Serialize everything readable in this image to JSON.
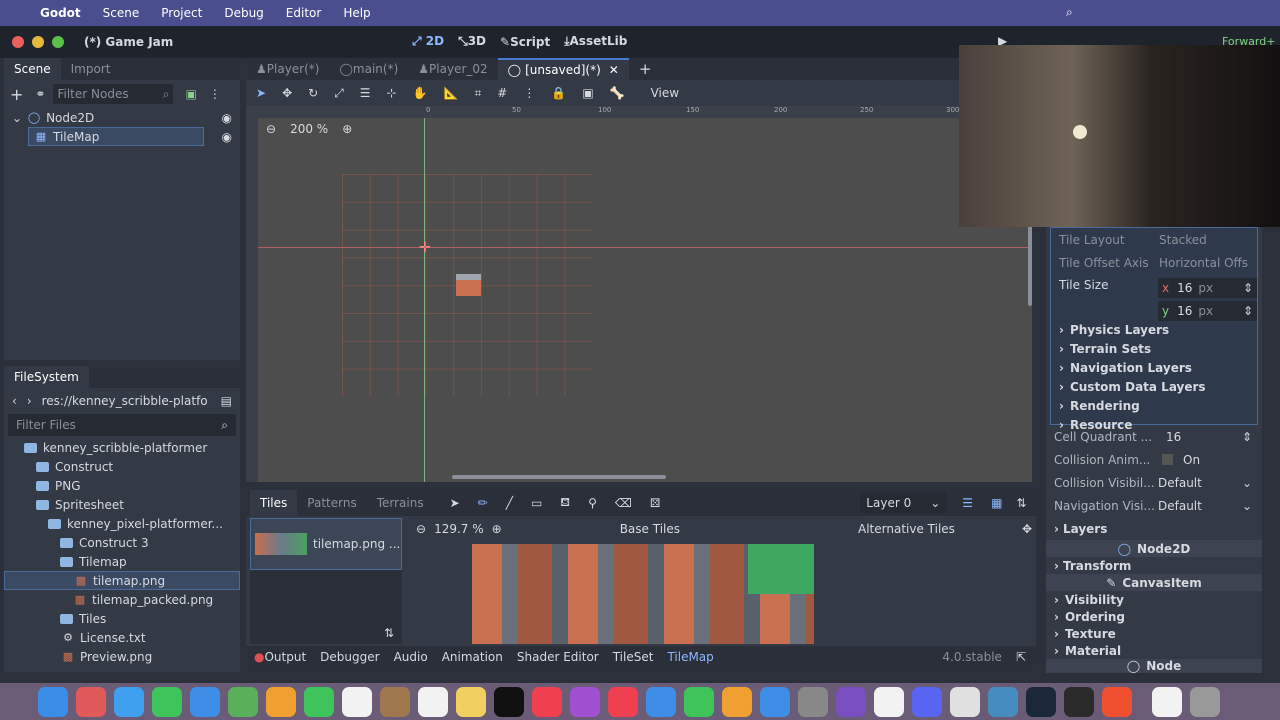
{
  "macos_menu": {
    "items": [
      "Godot",
      "Scene",
      "Project",
      "Debug",
      "Editor",
      "Help"
    ]
  },
  "editor_top": {
    "window_title": "(*) Game Jam",
    "workspaces": [
      "2D",
      "3D",
      "Script",
      "AssetLib"
    ],
    "renderer": "Forward+"
  },
  "scene_dock": {
    "tabs": [
      "Scene",
      "Import"
    ],
    "filter_placeholder": "Filter Nodes",
    "nodes": [
      "Node2D",
      "TileMap"
    ]
  },
  "filesystem_dock": {
    "title": "FileSystem",
    "path": "res://kenney_scribble-platfo",
    "filter_placeholder": "Filter Files",
    "items": [
      {
        "label": "kenney_scribble-platformer",
        "type": "folder",
        "indent": 1
      },
      {
        "label": "Construct",
        "type": "folder",
        "indent": 2
      },
      {
        "label": "PNG",
        "type": "folder",
        "indent": 2
      },
      {
        "label": "Spritesheet",
        "type": "folder",
        "indent": 2
      },
      {
        "label": "kenney_pixel-platformer...",
        "type": "folder",
        "indent": 3
      },
      {
        "label": "Construct 3",
        "type": "folder",
        "indent": 4
      },
      {
        "label": "Tilemap",
        "type": "folder",
        "indent": 4
      },
      {
        "label": "tilemap.png",
        "type": "image",
        "indent": 5
      },
      {
        "label": "tilemap_packed.png",
        "type": "image",
        "indent": 5
      },
      {
        "label": "Tiles",
        "type": "folder",
        "indent": 4
      },
      {
        "label": "License.txt",
        "type": "gear",
        "indent": 4
      },
      {
        "label": "Preview.png",
        "type": "image",
        "indent": 4
      }
    ]
  },
  "editor_tabs": [
    "Player(*)",
    "main(*)",
    "Player_02",
    "[unsaved](*)"
  ],
  "toolbar": {
    "view_label": "View"
  },
  "viewport": {
    "zoom": "200 %",
    "ruler_marks": [
      "0",
      "50",
      "100",
      "150",
      "200",
      "250",
      "300"
    ]
  },
  "tileset_panel": {
    "tabs": [
      "Tiles",
      "Patterns",
      "Terrains"
    ],
    "layer_select": "Layer 0",
    "source_item": "tilemap.png ...",
    "zoom": "129.7 %",
    "base_tiles_label": "Base Tiles",
    "alt_tiles_label": "Alternative Tiles"
  },
  "bottom_tabs": [
    "Output",
    "Debugger",
    "Audio",
    "Animation",
    "Shader Editor",
    "TileSet",
    "TileMap"
  ],
  "version": "4.0.stable",
  "inspector": {
    "tile_layout": {
      "label": "Tile Layout",
      "value": "Stacked"
    },
    "tile_offset_axis": {
      "label": "Tile Offset Axis",
      "value": "Horizontal Offs"
    },
    "tile_size": {
      "label": "Tile Size",
      "x_label": "x",
      "x": "16",
      "y_label": "y",
      "y": "16",
      "unit": "px"
    },
    "sections": [
      "Physics Layers",
      "Terrain Sets",
      "Navigation Layers",
      "Custom Data Layers",
      "Rendering",
      "Resource"
    ],
    "cell_quadrant": {
      "label": "Cell Quadrant ...",
      "value": "16"
    },
    "collision_anim": {
      "label": "Collision Anim...",
      "value": "On"
    },
    "collision_vis": {
      "label": "Collision Visibil...",
      "value": "Default"
    },
    "navigation_vis": {
      "label": "Navigation Visi...",
      "value": "Default"
    },
    "layers_label": "Layers",
    "node2d_header": "Node2D",
    "transform_label": "Transform",
    "canvasitem_header": "CanvasItem",
    "canvas_sections": [
      "Visibility",
      "Ordering",
      "Texture",
      "Material"
    ],
    "node_header": "Node"
  },
  "colors": {
    "accent": "#4b7bd0",
    "panel": "#333945",
    "dark": "#2a2f39",
    "grid": "#c0604a"
  }
}
